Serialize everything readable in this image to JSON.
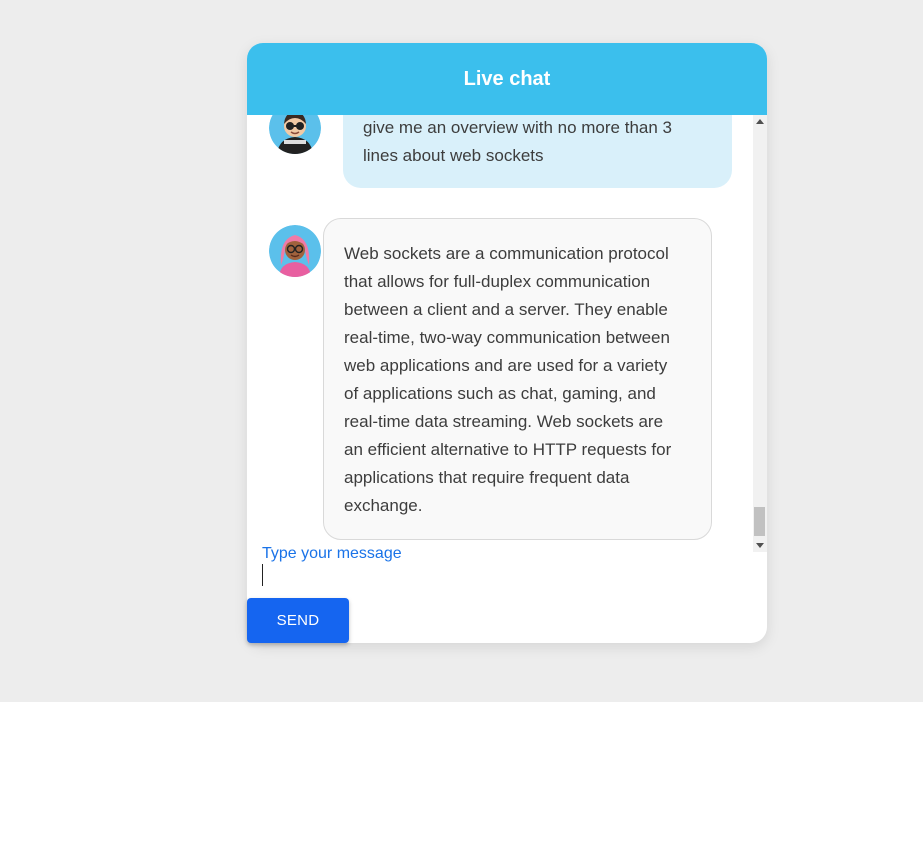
{
  "header": {
    "title": "Live chat"
  },
  "messages": [
    {
      "sender": "user",
      "avatar_icon": "user-avatar-icon",
      "text_lines": [
        "give me an overview with no more than 3",
        "lines about web sockets"
      ]
    },
    {
      "sender": "bot",
      "avatar_icon": "bot-avatar-icon",
      "text_lines": [
        "Web sockets are a communication protocol",
        "that allows for full-duplex communication",
        "between a client and a server. They enable",
        "real-time, two-way communication between",
        "web applications and are used for a variety",
        "of applications such as chat, gaming, and",
        "real-time data streaming. Web sockets are",
        "an efficient alternative to HTTP requests for",
        "applications that require frequent data",
        "exchange."
      ]
    }
  ],
  "input": {
    "placeholder": "Type your message",
    "value": ""
  },
  "send_button": {
    "label": "SEND"
  },
  "colors": {
    "header_bg": "#3bbfed",
    "user_bubble_bg": "#d9f0fa",
    "bot_bubble_bg": "#f9f9f9",
    "send_button_bg": "#1565f0",
    "placeholder_text": "#1a73e8"
  }
}
